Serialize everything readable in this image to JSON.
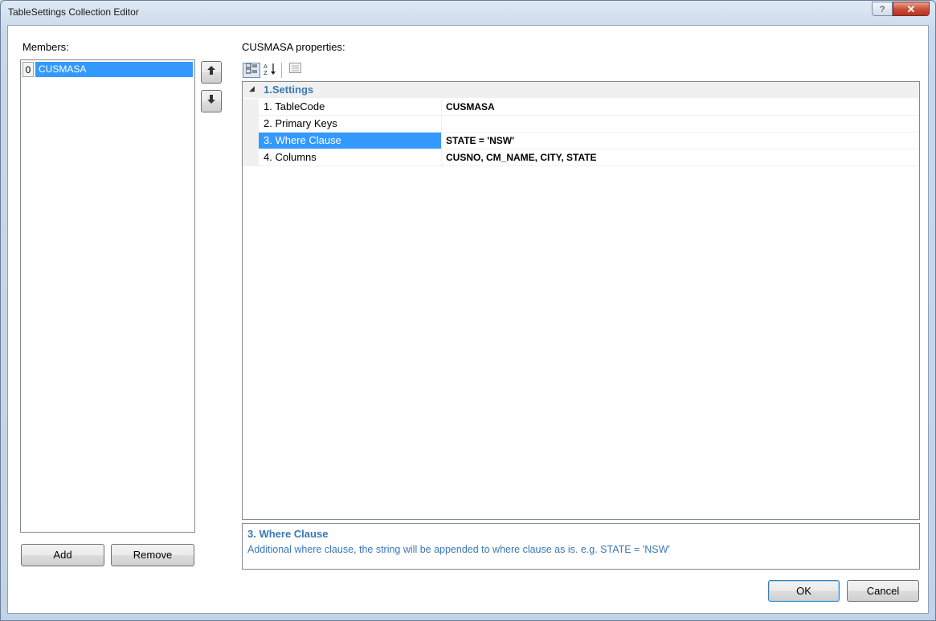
{
  "window": {
    "title": "TableSettings Collection Editor",
    "help_label": "?",
    "close_label": "✕"
  },
  "members": {
    "label": "Members:",
    "items": [
      {
        "index": "0",
        "name": "CUSMASA"
      }
    ],
    "up_icon": "arrow-up-icon",
    "down_icon": "arrow-down-icon",
    "add_label": "Add",
    "remove_label": "Remove"
  },
  "properties": {
    "label": "CUSMASA properties:",
    "toolbar": {
      "categorized_icon": "categorized-icon",
      "alphabetical_icon": "sort-az-icon",
      "pages_icon": "property-pages-icon"
    },
    "category": {
      "toggle": "◢",
      "name": "1.Settings"
    },
    "rows": [
      {
        "name": "1. TableCode",
        "value": "CUSMASA"
      },
      {
        "name": "2. Primary Keys",
        "value": ""
      },
      {
        "name": "3. Where Clause",
        "value": "STATE = 'NSW'"
      },
      {
        "name": "4. Columns",
        "value": "CUSNO, CM_NAME, CITY, STATE"
      }
    ]
  },
  "description": {
    "title": "3. Where Clause",
    "text": "Additional where clause, the string will be appended to where clause as is. e.g. STATE = 'NSW'"
  },
  "buttons": {
    "ok_label": "OK",
    "cancel_label": "Cancel"
  },
  "colors": {
    "selection": "#3399ff",
    "category_text": "#3a78b6"
  }
}
